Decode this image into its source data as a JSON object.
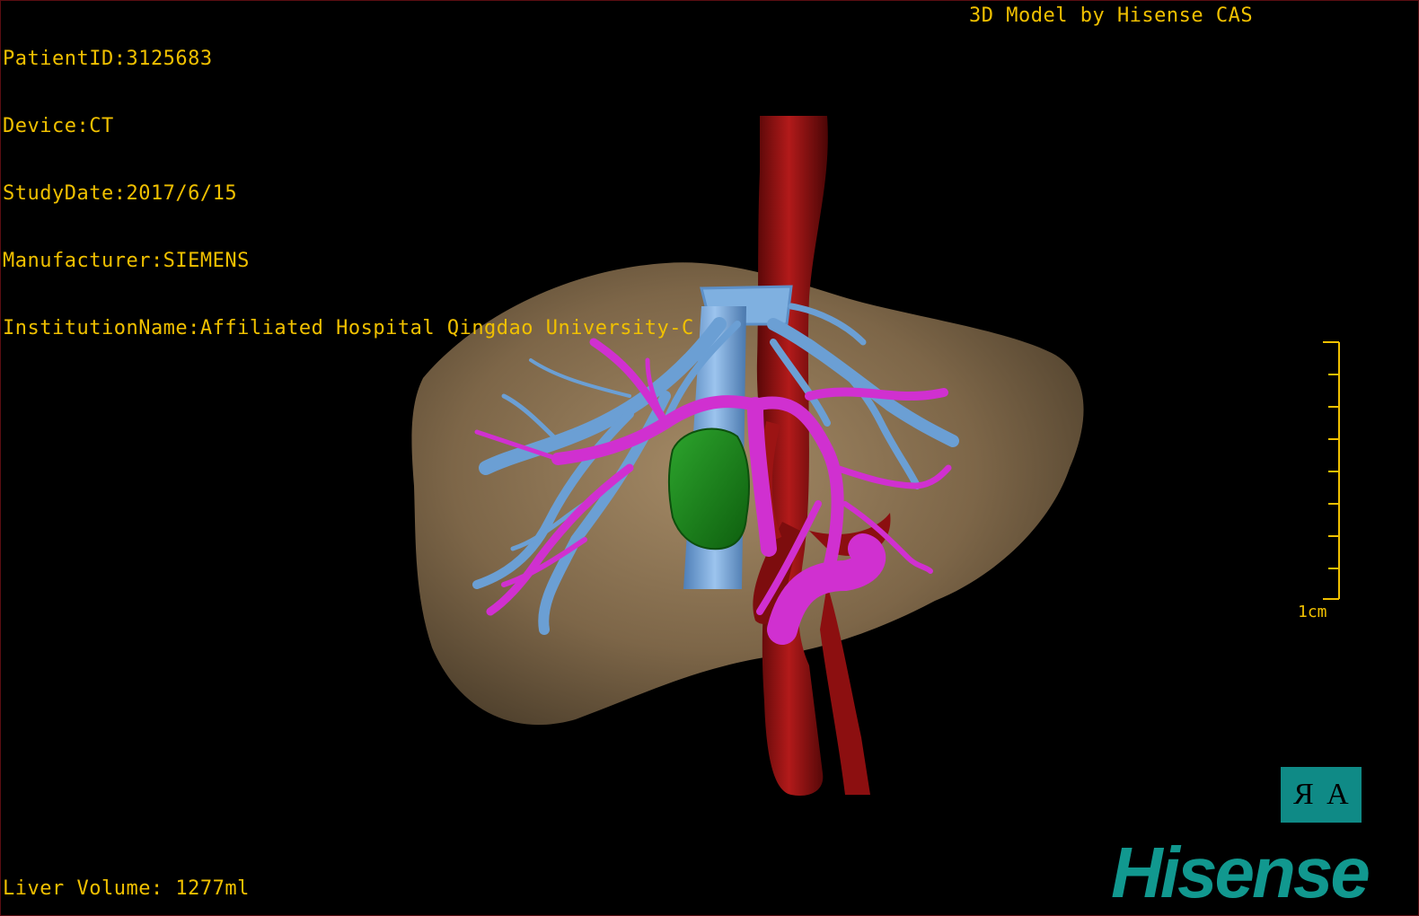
{
  "dicom": {
    "patient_id": "PatientID:3125683",
    "device": "Device:CT",
    "study_date": "StudyDate:2017/6/15",
    "manufacturer": "Manufacturer:SIEMENS",
    "institution": "InstitutionName:Affiliated Hospital Qingdao University-C"
  },
  "credit": "3D Model by Hisense CAS",
  "liver_volume": "Liver Volume: 1277ml",
  "scale_bar": {
    "label": "1cm",
    "ticks": 9
  },
  "orientation": {
    "left_glyph": "R",
    "right_glyph": "A"
  },
  "brand": "Hisense",
  "colors": {
    "background": "#000000",
    "overlay_text": "#f0c000",
    "liver": "#8a7354",
    "aorta": "#8c0f10",
    "hepatic_veins": "#6b9fd4",
    "portal_vein": "#d030d0",
    "tumor": "#1e8a1e",
    "brand": "#11988f"
  }
}
